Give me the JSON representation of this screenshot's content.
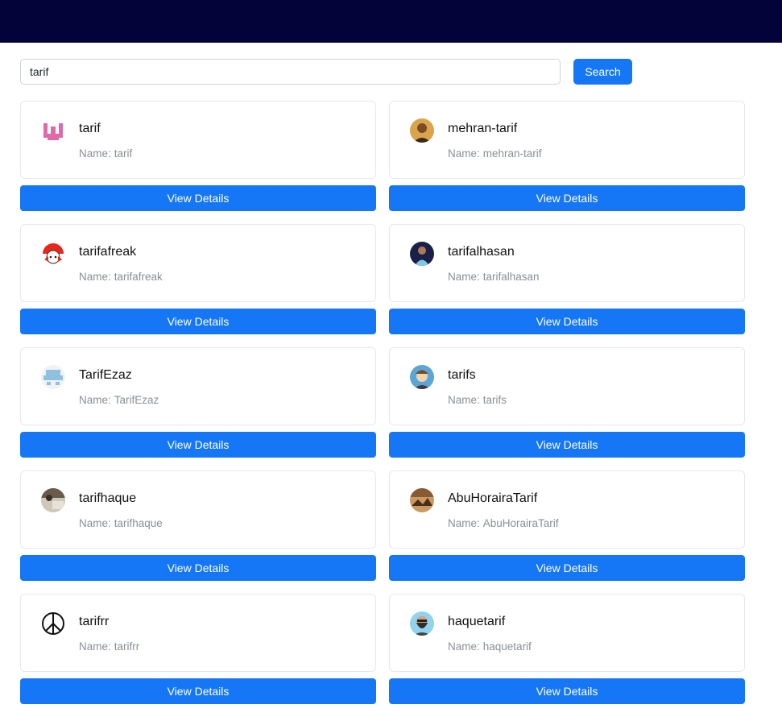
{
  "search": {
    "value": "tarif",
    "button_label": "Search"
  },
  "results": [
    {
      "username": "tarif",
      "name_label": "Name:",
      "name": "tarif",
      "avatar": "pink-identicon",
      "button_label": "View Details"
    },
    {
      "username": "mehran-tarif",
      "name_label": "Name:",
      "name": "mehran-tarif",
      "avatar": "user-photo",
      "button_label": "View Details"
    },
    {
      "username": "tarifafreak",
      "name_label": "Name:",
      "name": "tarifafreak",
      "avatar": "red-mascot",
      "button_label": "View Details"
    },
    {
      "username": "tarifalhasan",
      "name_label": "Name:",
      "name": "tarifalhasan",
      "avatar": "user-photo",
      "button_label": "View Details"
    },
    {
      "username": "TarifEzaz",
      "name_label": "Name:",
      "name": "TarifEzaz",
      "avatar": "blue-identicon",
      "button_label": "View Details"
    },
    {
      "username": "tarifs",
      "name_label": "Name:",
      "name": "tarifs",
      "avatar": "cartoon-avatar",
      "button_label": "View Details"
    },
    {
      "username": "tarifhaque",
      "name_label": "Name:",
      "name": "tarifhaque",
      "avatar": "user-photo",
      "button_label": "View Details"
    },
    {
      "username": "AbuHorairaTarif",
      "name_label": "Name:",
      "name": "AbuHorairaTarif",
      "avatar": "landscape-photo",
      "button_label": "View Details"
    },
    {
      "username": "tarifrr",
      "name_label": "Name:",
      "name": "tarifrr",
      "avatar": "peace-symbol",
      "button_label": "View Details"
    },
    {
      "username": "haquetarif",
      "name_label": "Name:",
      "name": "haquetarif",
      "avatar": "bearded-illustration",
      "button_label": "View Details"
    }
  ],
  "colors": {
    "topbar": "#03033a",
    "primary": "#1677f6",
    "muted_text": "#8a8f96"
  }
}
